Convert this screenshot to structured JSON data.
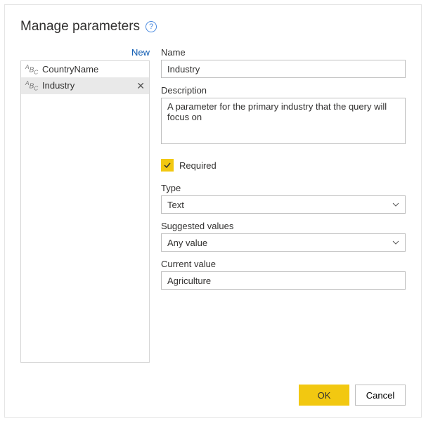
{
  "header": {
    "title": "Manage parameters"
  },
  "toolbar": {
    "new_label": "New"
  },
  "param_list": {
    "items": [
      {
        "name": "CountryName",
        "selected": false
      },
      {
        "name": "Industry",
        "selected": true
      }
    ]
  },
  "form": {
    "name_label": "Name",
    "name_value": "Industry",
    "description_label": "Description",
    "description_value": "A parameter for the primary industry that the query will focus on",
    "required_label": "Required",
    "required_checked": true,
    "type_label": "Type",
    "type_value": "Text",
    "suggested_label": "Suggested values",
    "suggested_value": "Any value",
    "current_label": "Current value",
    "current_value": "Agriculture"
  },
  "buttons": {
    "ok_label": "OK",
    "cancel_label": "Cancel"
  }
}
